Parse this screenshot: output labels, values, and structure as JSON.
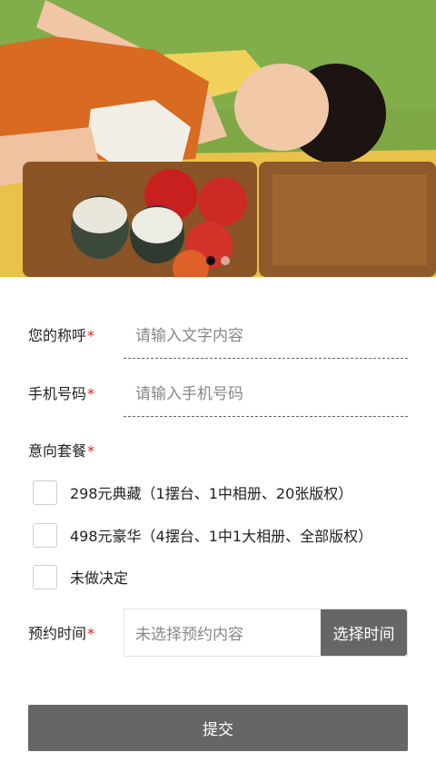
{
  "banner": {
    "image_desc": "photo-banner",
    "slides_total": 2,
    "active_slide": 1
  },
  "form": {
    "name": {
      "label": "您的称呼",
      "required_mark": "*",
      "placeholder": "请输入文字内容"
    },
    "phone": {
      "label": "手机号码",
      "required_mark": "*",
      "placeholder": "请输入手机号码"
    },
    "package": {
      "label": "意向套餐",
      "required_mark": "*",
      "options": [
        {
          "label": "298元典藏（1摆台、1中相册、20张版权）",
          "checked": false
        },
        {
          "label": "498元豪华（4摆台、1中1大相册、全部版权）",
          "checked": false
        },
        {
          "label": "未做决定",
          "checked": false
        }
      ]
    },
    "time": {
      "label": "预约时间",
      "required_mark": "*",
      "value": "未选择预约内容",
      "button_label": "选择时间"
    },
    "submit_label": "提交"
  },
  "colors": {
    "accent_gray": "#666666",
    "required": "#e02020",
    "placeholder": "#888888"
  }
}
